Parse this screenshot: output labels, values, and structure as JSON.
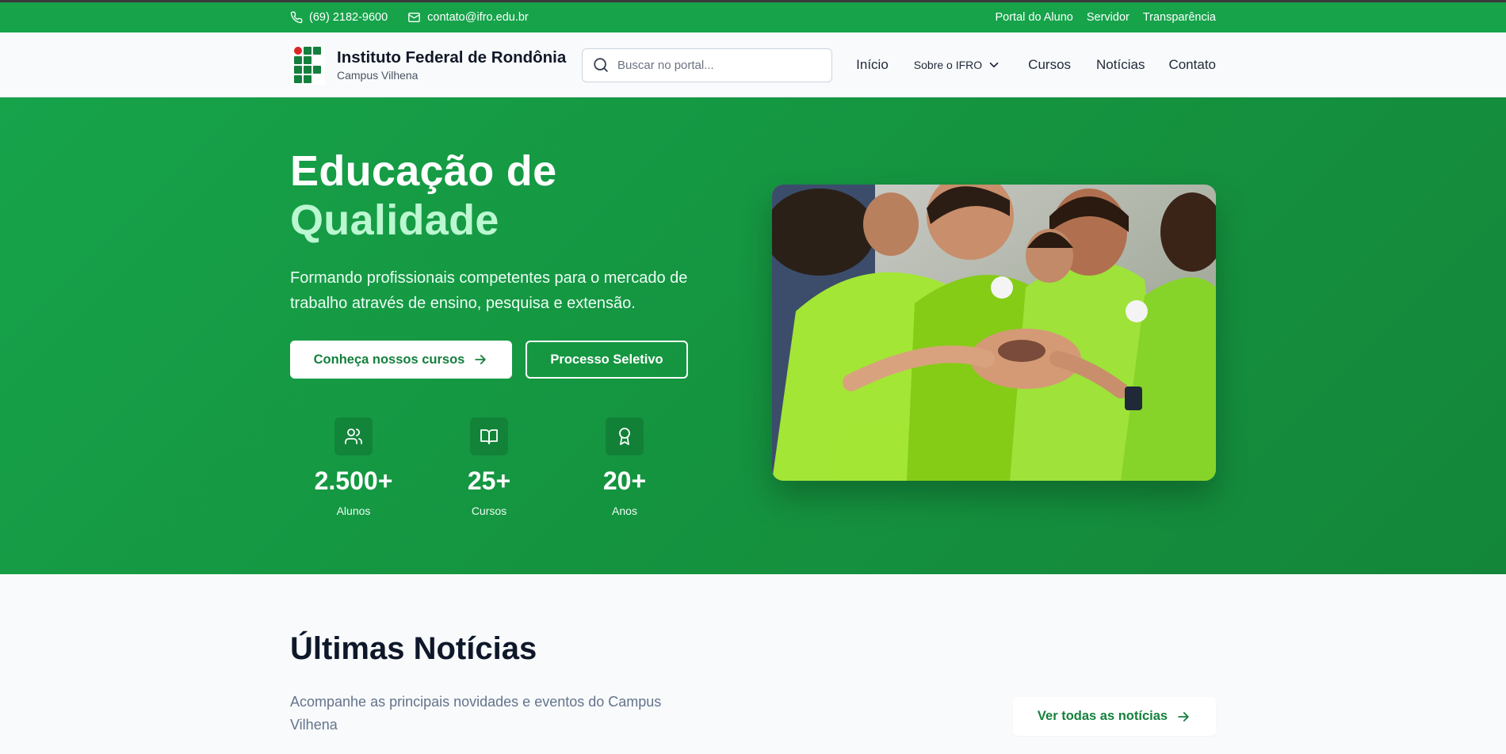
{
  "topbar": {
    "phone": "(69) 2182-9600",
    "email": "contato@ifro.edu.br",
    "links": [
      "Portal do Aluno",
      "Servidor",
      "Transparência"
    ]
  },
  "header": {
    "brand_name": "Instituto Federal de Rondônia",
    "brand_sub": "Campus Vilhena",
    "search_placeholder": "Buscar no portal...",
    "nav": {
      "inicio": "Início",
      "sobre": "Sobre o IFRO",
      "cursos": "Cursos",
      "noticias": "Notícias",
      "contato": "Contato"
    }
  },
  "hero": {
    "title_line1": "Educação de",
    "title_line2": "Qualidade",
    "lead": "Formando profissionais competentes para o mercado de trabalho através de ensino, pesquisa e extensão.",
    "primary_button": "Conheça nossos cursos",
    "secondary_button": "Processo Seletivo",
    "stats": [
      {
        "icon": "users-icon",
        "value": "2.500+",
        "label": "Alunos"
      },
      {
        "icon": "book-open-icon",
        "value": "25+",
        "label": "Cursos"
      },
      {
        "icon": "award-icon",
        "value": "20+",
        "label": "Anos"
      }
    ]
  },
  "news": {
    "title": "Últimas Notícias",
    "description": "Acompanhe as principais novidades e eventos do Campus Vilhena",
    "button": "Ver todas as notícias"
  },
  "colors": {
    "primary": "#16a34a",
    "accent_light": "#bbf7d0",
    "text_dark": "#0f172a"
  }
}
